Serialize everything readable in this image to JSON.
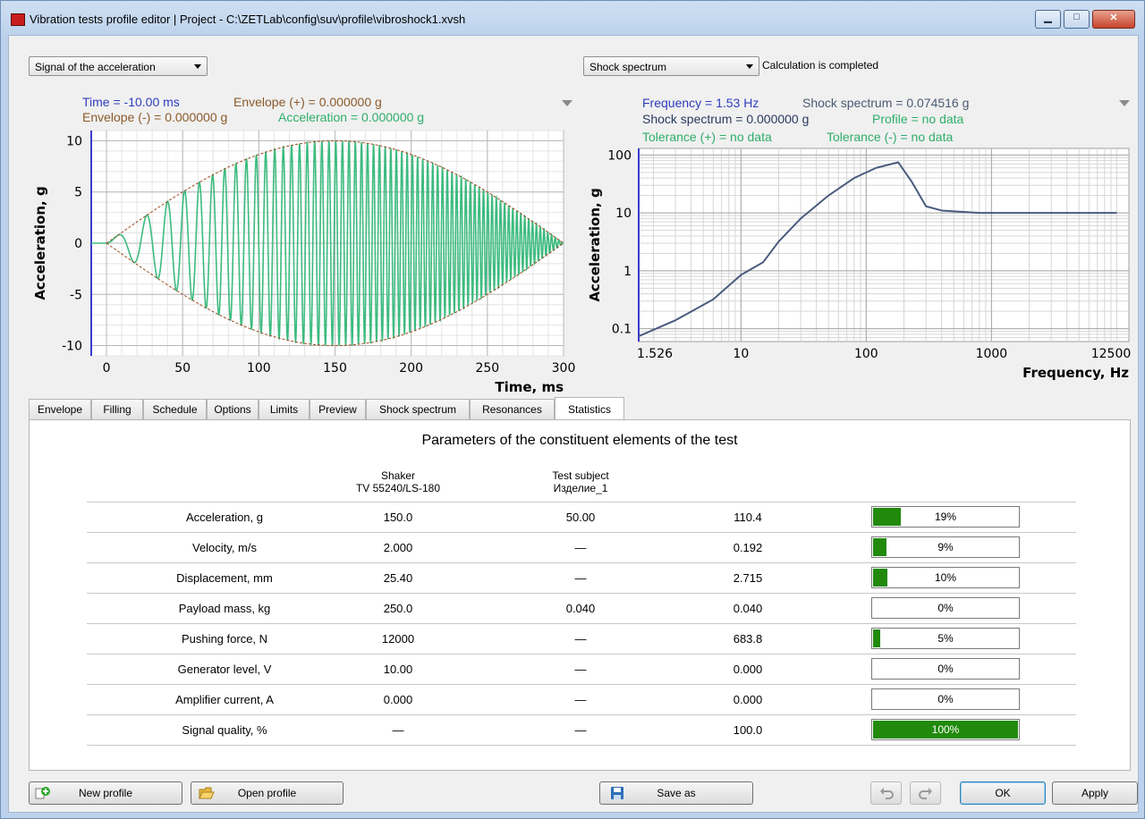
{
  "window": {
    "title": "Vibration tests profile editor | Project - C:\\ZETLab\\config\\suv\\profile\\vibroshock1.xvsh",
    "controls": [
      "minimize-icon",
      "maximize-icon",
      "close-icon"
    ]
  },
  "left_chart": {
    "selector": "Signal of the acceleration",
    "readout": {
      "time": "Time = -10.00 ms",
      "env_pos": "Envelope (+) = 0.000000 g",
      "env_neg": "Envelope (-) = 0.000000 g",
      "accel": "Acceleration = 0.000000 g"
    }
  },
  "right_chart": {
    "selector": "Shock spectrum",
    "status": "Calculation is completed",
    "readout": {
      "frequency": "Frequency = 1.53 Hz",
      "shock1": "Shock spectrum = 0.074516 g",
      "shock2": "Shock spectrum = 0.000000 g",
      "profile": "Profile = no data",
      "tol_pos": "Tolerance (+) = no data",
      "tol_neg": "Tolerance (-) = no data"
    }
  },
  "chart_data": [
    {
      "type": "line",
      "xlabel": "Time, ms",
      "ylabel": "Acceleration, g",
      "xlim": [
        -10,
        300
      ],
      "ylim": [
        -11,
        11
      ],
      "xticks": [
        0,
        50,
        100,
        150,
        200,
        250,
        300
      ],
      "yticks": [
        10,
        5,
        0,
        -5,
        -10
      ],
      "grid": true,
      "series": [
        {
          "name": "Envelope (+)",
          "style": "dashed",
          "color": "#9b4a1e",
          "function": "10*sin(pi*t/300)",
          "x_range": [
            0,
            300
          ]
        },
        {
          "name": "Envelope (-)",
          "style": "dashed",
          "color": "#9b4a1e",
          "function": "-10*sin(pi*t/300)",
          "x_range": [
            0,
            300
          ]
        },
        {
          "name": "Acceleration",
          "color": "#3dbb7f",
          "function": "10*sin(pi*t/300)*sin(2*pi*f(t)*t), frequency rising with time",
          "x_range": [
            0,
            300
          ]
        }
      ]
    },
    {
      "type": "line",
      "xlabel": "Frequency, Hz",
      "ylabel": "Acceleration, g",
      "xscale": "log",
      "yscale": "log",
      "xlim": [
        1.526,
        12500
      ],
      "ylim": [
        0.06,
        130
      ],
      "xticks": [
        "1.526",
        "10",
        "100",
        "1000",
        "12500"
      ],
      "yticks": [
        "100",
        "10",
        "1",
        "0.1"
      ],
      "grid": true,
      "series": [
        {
          "name": "Shock spectrum",
          "color": "#4a5b7e",
          "x": [
            1.526,
            3,
            6,
            10,
            15,
            20,
            30,
            50,
            80,
            120,
            180,
            230,
            300,
            400,
            800,
            2000,
            10000
          ],
          "y": [
            0.074,
            0.14,
            0.32,
            0.85,
            1.4,
            3.2,
            8,
            20,
            40,
            60,
            75,
            35,
            13,
            11,
            10,
            10,
            10
          ]
        }
      ]
    }
  ],
  "tabs": [
    {
      "label": "Envelope",
      "w": 70
    },
    {
      "label": "Filling",
      "w": 58
    },
    {
      "label": "Schedule",
      "w": 71
    },
    {
      "label": "Options",
      "w": 58
    },
    {
      "label": "Limits",
      "w": 57
    },
    {
      "label": "Preview",
      "w": 63
    },
    {
      "label": "Shock spectrum",
      "w": 116
    },
    {
      "label": "Resonances",
      "w": 95
    },
    {
      "label": "Statistics",
      "w": 78
    }
  ],
  "stats": {
    "title": "Parameters of the constituent elements of the test",
    "shaker_head": "Shaker",
    "shaker_model": "TV 55240/LS-180",
    "subject_head": "Test subject",
    "subject_name": "Изделие_1",
    "rows": [
      {
        "param": "Acceleration, g",
        "shaker": "150.0",
        "subject": "50.00",
        "value": "110.4",
        "pct": "19%",
        "fill": 0.19
      },
      {
        "param": "Velocity, m/s",
        "shaker": "2.000",
        "subject": "—",
        "value": "0.192",
        "pct": "9%",
        "fill": 0.09
      },
      {
        "param": "Displacement, mm",
        "shaker": "25.40",
        "subject": "—",
        "value": "2.715",
        "pct": "10%",
        "fill": 0.1
      },
      {
        "param": "Payload mass, kg",
        "shaker": "250.0",
        "subject": "0.040",
        "value": "0.040",
        "pct": "0%",
        "fill": 0.0
      },
      {
        "param": "Pushing force, N",
        "shaker": "12000",
        "subject": "—",
        "value": "683.8",
        "pct": "5%",
        "fill": 0.05
      },
      {
        "param": "Generator level, V",
        "shaker": "10.00",
        "subject": "—",
        "value": "0.000",
        "pct": "0%",
        "fill": 0.0
      },
      {
        "param": "Amplifier current, A",
        "shaker": "0.000",
        "subject": "—",
        "value": "0.000",
        "pct": "0%",
        "fill": 0.0
      },
      {
        "param": "Signal quality, %",
        "shaker": "—",
        "subject": "—",
        "value": "100.0",
        "pct": "100%",
        "fill": 1.0
      }
    ]
  },
  "buttons": {
    "new_profile": "New profile",
    "open_profile": "Open profile",
    "save_as": "Save as",
    "ok": "OK",
    "apply": "Apply"
  },
  "colors": {
    "progress_fill": "#218a0c",
    "signal_green": "#3dbb7f",
    "envelope_brown": "#9b4a1e",
    "spectrum_line": "#4a5b7e",
    "axis_blue": "#3a3ad0"
  }
}
